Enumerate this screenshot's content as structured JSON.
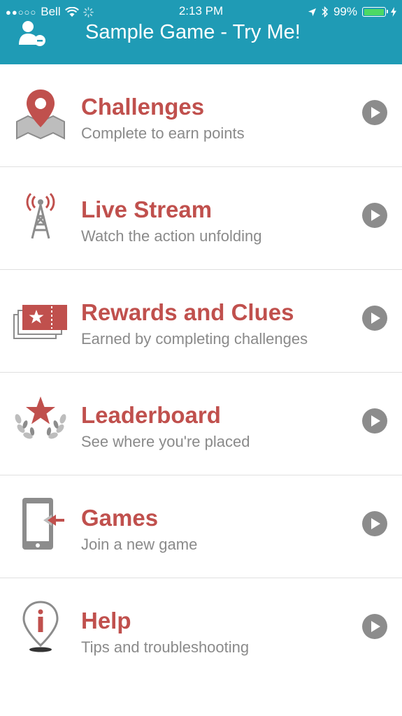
{
  "status_bar": {
    "signal": "●●○○○",
    "carrier": "Bell",
    "time": "2:13 PM",
    "battery_percent": "99%",
    "battery_level": 0.99
  },
  "header": {
    "title": "Sample Game - Try Me!"
  },
  "menu": [
    {
      "title": "Challenges",
      "subtitle": "Complete to earn points",
      "icon": "map-pin-icon"
    },
    {
      "title": "Live Stream",
      "subtitle": "Watch the action unfolding",
      "icon": "broadcast-tower-icon"
    },
    {
      "title": "Rewards and Clues",
      "subtitle": "Earned by completing challenges",
      "icon": "ticket-star-icon"
    },
    {
      "title": "Leaderboard",
      "subtitle": "See where you're placed",
      "icon": "laurel-star-icon"
    },
    {
      "title": "Games",
      "subtitle": "Join a new game",
      "icon": "phone-enter-icon"
    },
    {
      "title": "Help",
      "subtitle": "Tips and troubleshooting",
      "icon": "info-pin-icon"
    }
  ],
  "colors": {
    "header_bg": "#1f9bb5",
    "accent_red": "#c0504d",
    "subtitle_gray": "#8a8a8a",
    "icon_gray": "#8c8c8c"
  }
}
